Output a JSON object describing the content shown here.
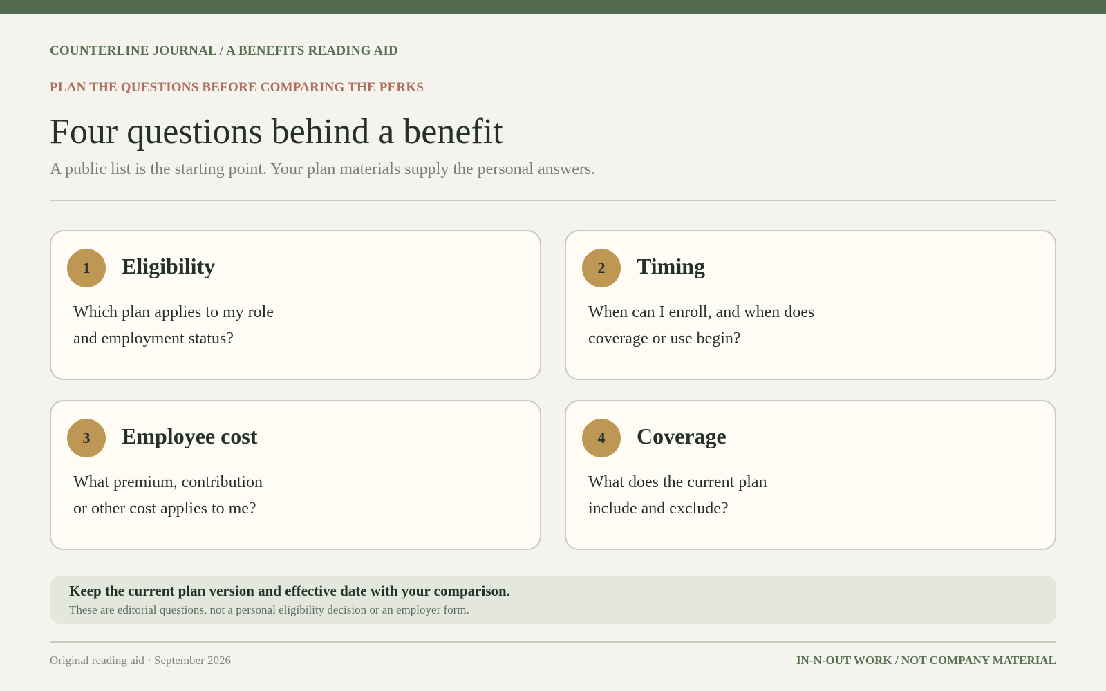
{
  "header": {
    "kicker": "COUNTERLINE JOURNAL / A BENEFITS READING AID",
    "eyebrow": "PLAN THE QUESTIONS BEFORE COMPARING THE PERKS",
    "title": "Four questions behind a benefit",
    "subtitle": "A public list is the starting point. Your plan materials supply the personal answers."
  },
  "cards": [
    {
      "number": "1",
      "title": "Eligibility",
      "line1": "Which plan applies to my role",
      "line2": "and employment status?"
    },
    {
      "number": "2",
      "title": "Timing",
      "line1": "When can I enroll, and when does",
      "line2": "coverage or use begin?"
    },
    {
      "number": "3",
      "title": "Employee cost",
      "line1": "What premium, contribution",
      "line2": "or other cost applies to me?"
    },
    {
      "number": "4",
      "title": "Coverage",
      "line1": "What does the current plan",
      "line2": "include and exclude?"
    }
  ],
  "note": {
    "main": "Keep the current plan version and effective date with your comparison.",
    "sub": "These are editorial questions, not a personal eligibility decision or an employer form."
  },
  "footer": {
    "left": "Original reading aid · September 2026",
    "right": "IN-N-OUT WORK / NOT COMPANY MATERIAL"
  },
  "colors": {
    "top_bar": "#516b4f",
    "background": "#f4f3ed",
    "accent_gold": "#bd9753",
    "eyebrow_rust": "#ac6e59",
    "green_text": "#567050",
    "note_background": "#e3e7dc"
  }
}
